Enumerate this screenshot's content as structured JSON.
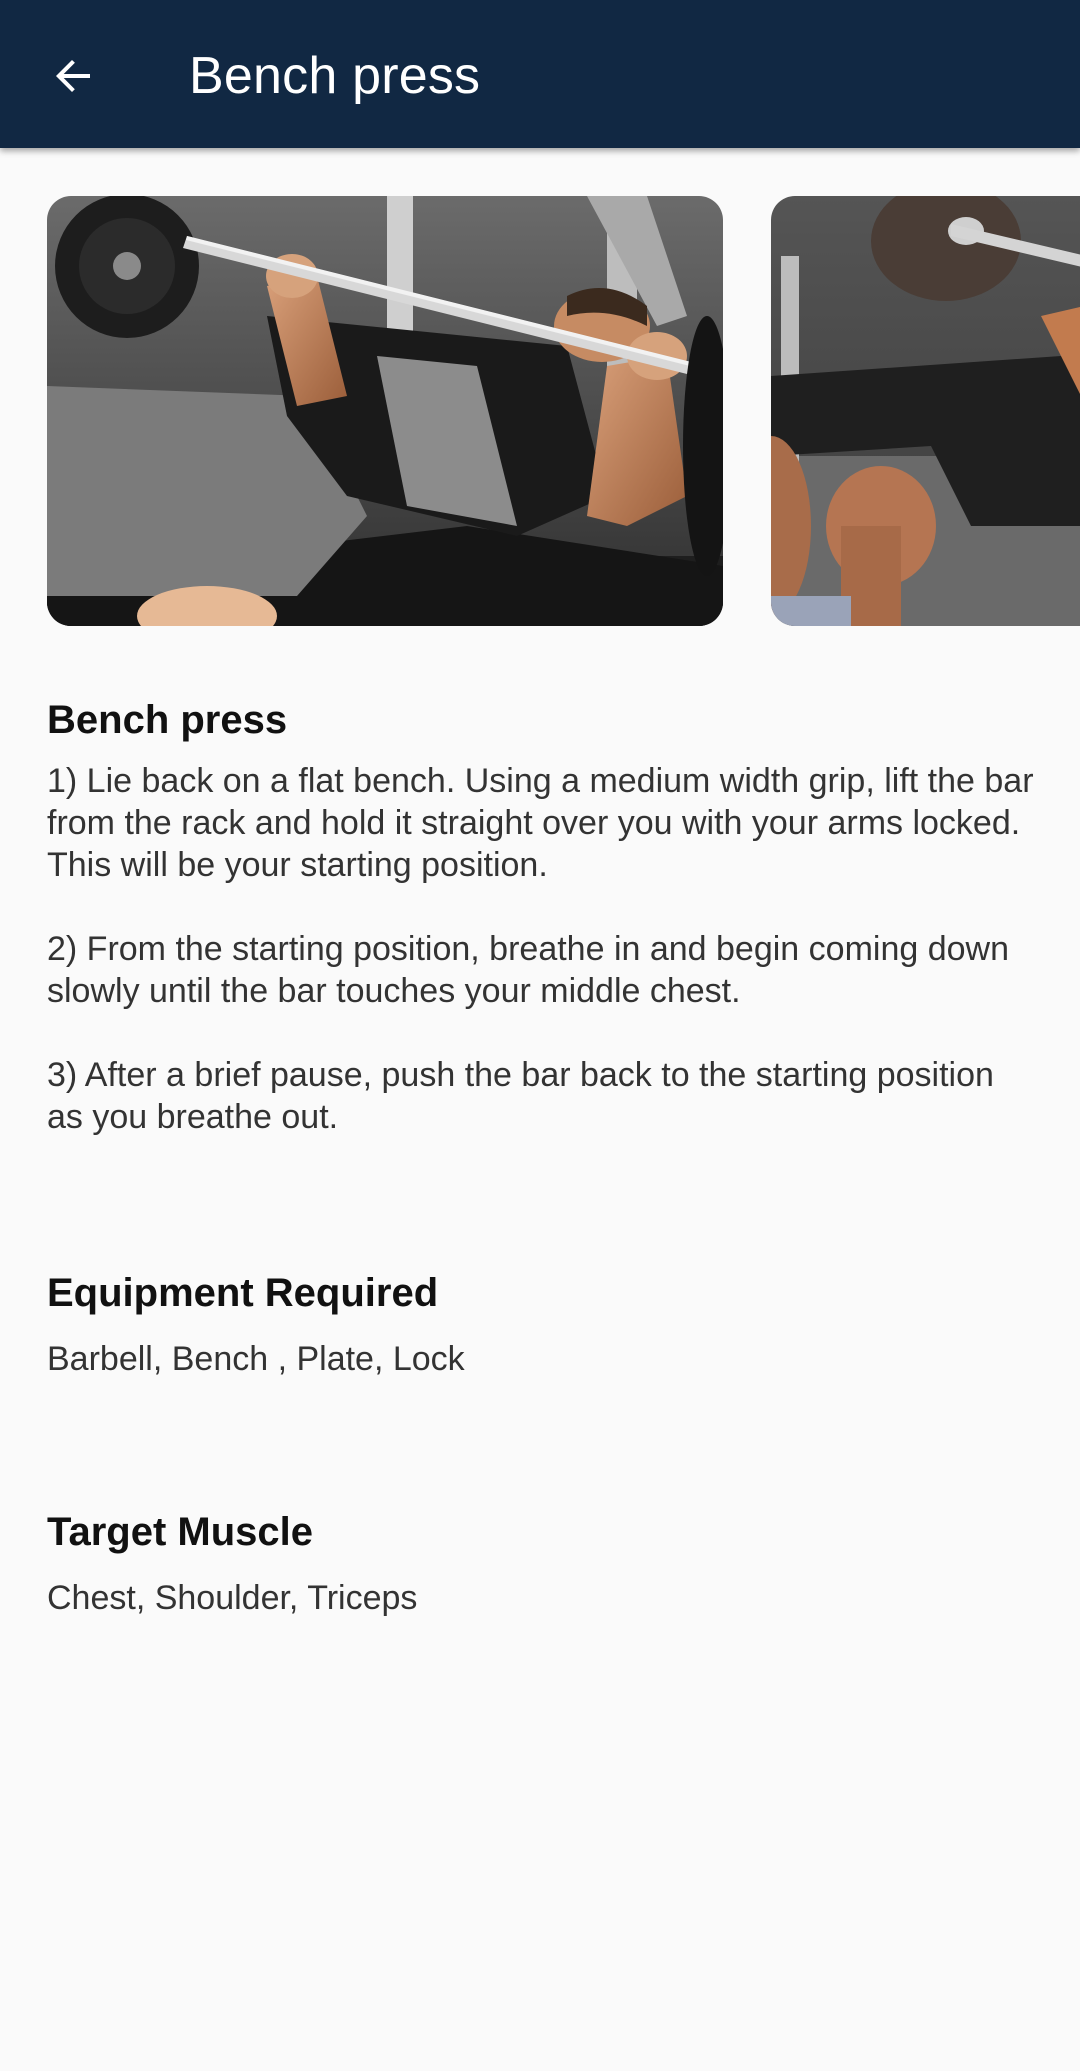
{
  "appbar": {
    "title": "Bench press",
    "background": "#112843"
  },
  "carousel": {
    "images": [
      {
        "subject": "man-lying-on-bench-lifting-barbell"
      },
      {
        "subject": "man-on-bench-with-barbell-side-view"
      }
    ]
  },
  "exercise": {
    "name": "Bench press",
    "steps": [
      "1) Lie back on a flat bench. Using a medium width grip, lift the bar from the rack and hold it straight over you with your arms locked. This will be your starting position.",
      "2) From the starting position, breathe in and begin coming down slowly until the bar touches your middle chest.",
      "3) After a brief pause, push the bar back to the starting position as you breathe out."
    ]
  },
  "equipment": {
    "heading": "Equipment Required",
    "value": "Barbell, Bench , Plate, Lock"
  },
  "target_muscle": {
    "heading": "Target Muscle",
    "value": "Chest, Shoulder, Triceps"
  },
  "icons": {
    "back": "arrow-left-icon"
  }
}
